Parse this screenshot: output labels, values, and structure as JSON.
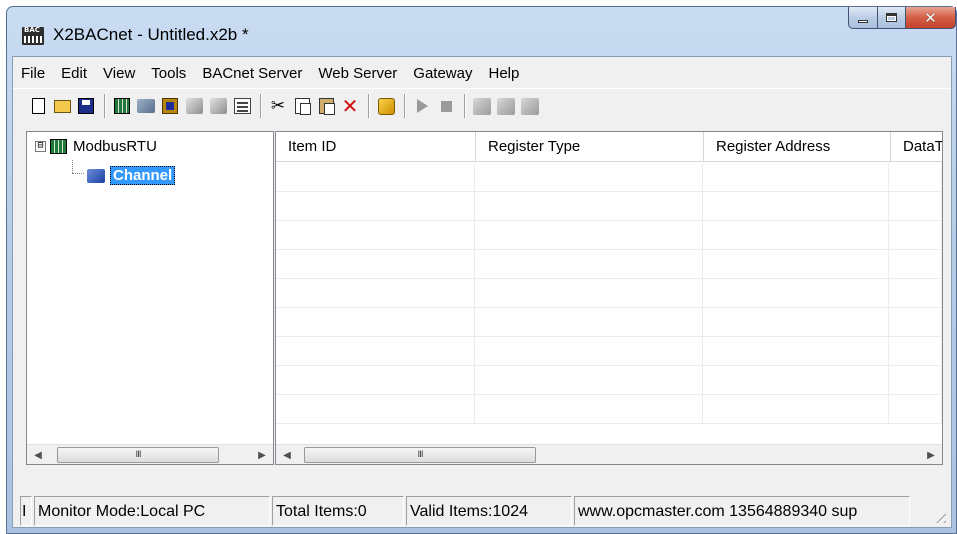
{
  "window": {
    "title": "X2BACnet - Untitled.x2b *",
    "icon": "bacnet-app-icon",
    "caption_buttons": [
      "minimize-icon",
      "maximize-icon",
      "close-icon"
    ]
  },
  "menu": {
    "items": [
      "File",
      "Edit",
      "View",
      "Tools",
      "BACnet Server",
      "Web Server",
      "Gateway",
      "Help"
    ]
  },
  "toolbar": {
    "buttons": [
      {
        "icon": "new-file-icon",
        "enabled": true
      },
      {
        "icon": "open-folder-icon",
        "enabled": true
      },
      {
        "icon": "save-icon",
        "enabled": true
      },
      {
        "icon": "add-device-icon",
        "enabled": true
      },
      {
        "icon": "add-channel-icon",
        "enabled": true
      },
      {
        "icon": "add-item-icon",
        "enabled": true
      },
      {
        "icon": "device-settings-icon",
        "enabled": false
      },
      {
        "icon": "device-info-icon",
        "enabled": false
      },
      {
        "icon": "properties-icon",
        "enabled": true
      },
      {
        "icon": "cut-icon",
        "enabled": true
      },
      {
        "icon": "copy-icon",
        "enabled": true
      },
      {
        "icon": "paste-icon",
        "enabled": true
      },
      {
        "icon": "delete-icon",
        "enabled": true
      },
      {
        "icon": "run-config-icon",
        "enabled": true
      },
      {
        "icon": "play-icon",
        "enabled": false
      },
      {
        "icon": "stop-icon",
        "enabled": false
      },
      {
        "icon": "tools-icon",
        "enabled": false
      },
      {
        "icon": "load-icon",
        "enabled": false
      },
      {
        "icon": "unload-icon",
        "enabled": false
      }
    ]
  },
  "tree": {
    "root": {
      "label": "ModbusRTU",
      "expander": "⊟",
      "icon": "modbus-device-icon"
    },
    "child": {
      "label": "Channel",
      "icon": "channel-icon",
      "selected": true
    }
  },
  "list": {
    "columns": [
      "Item ID",
      "Register Type",
      "Register Address",
      "DataT"
    ],
    "rows": []
  },
  "scrollbars": {
    "left_arrow": "◀",
    "right_arrow": "▶",
    "grip": "III"
  },
  "status": {
    "panels": [
      "I",
      "Monitor Mode:Local PC",
      "Total Items:0",
      "Valid Items:1024",
      "www.opcmaster.com 13564889340 sup"
    ]
  }
}
